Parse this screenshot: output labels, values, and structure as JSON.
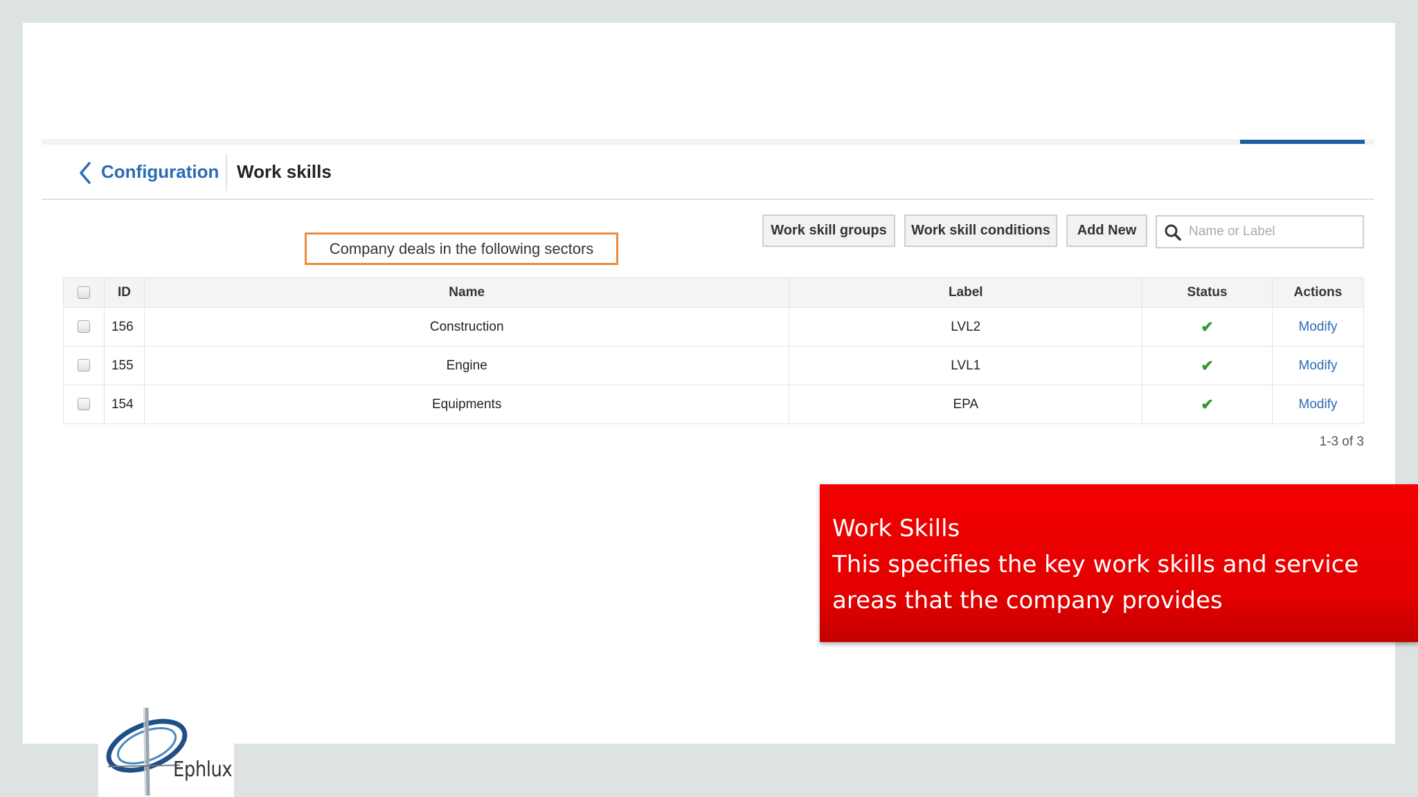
{
  "header": {
    "breadcrumb_link": "Configuration",
    "title": "Work skills"
  },
  "callout": "Company deals in the following sectors",
  "toolbar": {
    "groups_label": "Work skill groups",
    "conditions_label": "Work skill conditions",
    "add_label": "Add New",
    "search_placeholder": "Name or Label",
    "search_value": ""
  },
  "table": {
    "columns": [
      "ID",
      "Name",
      "Label",
      "Status",
      "Actions"
    ],
    "rows": [
      {
        "id": "156",
        "name": "Construction",
        "label": "LVL2",
        "status": "✔",
        "action": "Modify"
      },
      {
        "id": "155",
        "name": "Engine",
        "label": "LVL1",
        "status": "✔",
        "action": "Modify"
      },
      {
        "id": "154",
        "name": "Equipments",
        "label": "EPA",
        "status": "✔",
        "action": "Modify"
      }
    ]
  },
  "pager": "1-3 of 3",
  "banner": {
    "line1": "Work Skills",
    "line2": "This specifies the key work skills and service",
    "line3": "areas that the company provides"
  },
  "logo": {
    "text": "Ephlux"
  },
  "colors": {
    "link": "#2a6bb5",
    "accent": "#1e5f9e",
    "callout_border": "#ed8a3a",
    "banner": "#e60000",
    "status_ok": "#2d9c2d"
  }
}
